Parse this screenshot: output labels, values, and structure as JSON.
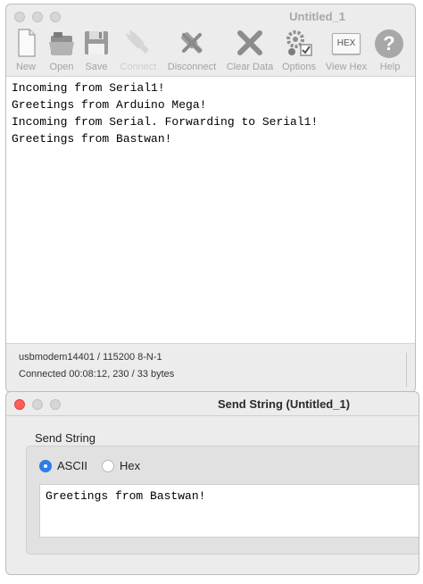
{
  "main_window": {
    "title": "Untitled_1"
  },
  "toolbar": {
    "items": [
      {
        "label": "New",
        "icon": "new-document-icon"
      },
      {
        "label": "Open",
        "icon": "open-folder-icon"
      },
      {
        "label": "Save",
        "icon": "save-floppy-icon"
      },
      {
        "label": "Connect",
        "icon": "usb-plug-icon",
        "enabled": false
      },
      {
        "label": "Disconnect",
        "icon": "disconnect-plug-icon"
      },
      {
        "label": "Clear Data",
        "icon": "clear-x-icon"
      },
      {
        "label": "Options",
        "icon": "gears-checkbox-icon"
      },
      {
        "label": "View Hex",
        "icon": "hex-icon",
        "icon_text": "HEX"
      },
      {
        "label": "Help",
        "icon": "help-question-icon",
        "icon_text": "?"
      }
    ]
  },
  "console": {
    "lines": [
      "Incoming from Serial1!",
      "Greetings from Arduino Mega!",
      "Incoming from Serial. Forwarding to Serial1!",
      "Greetings from Bastwan!"
    ]
  },
  "status": {
    "port": "usbmodem14401 / 115200 8-N-1",
    "connection": "Connected 00:08:12, 230 / 33 bytes"
  },
  "send_window": {
    "title": "Send String (Untitled_1)",
    "group_label": "Send String",
    "radio_ascii": "ASCII",
    "radio_hex": "Hex",
    "selected": "ASCII",
    "input_value": "Greetings from Bastwan!"
  },
  "colors": {
    "accent": "#2b7de9",
    "close_red": "#fe5f57",
    "toolbar_text": "#a3a3a3"
  }
}
